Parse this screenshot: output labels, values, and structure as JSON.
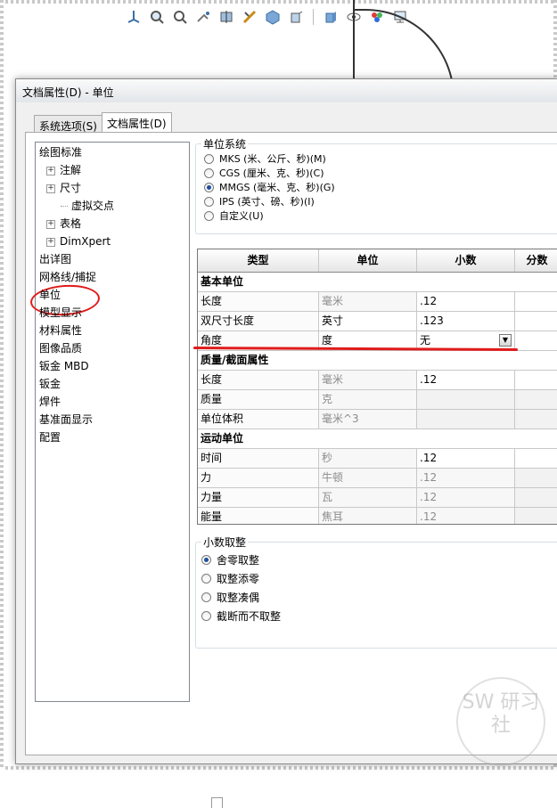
{
  "window": {
    "title": "文档属性(D) - 单位"
  },
  "tabs": [
    {
      "label": "系统选项(S)"
    },
    {
      "label": "文档属性(D)"
    }
  ],
  "tree": {
    "items": [
      {
        "label": "绘图标准",
        "indent": 0,
        "expand": false
      },
      {
        "label": "注解",
        "indent": 1,
        "expand": true
      },
      {
        "label": "尺寸",
        "indent": 1,
        "expand": true
      },
      {
        "label": "虚拟交点",
        "indent": 2,
        "expand": false
      },
      {
        "label": "表格",
        "indent": 1,
        "expand": true
      },
      {
        "label": "DimXpert",
        "indent": 1,
        "expand": true
      },
      {
        "label": "出详图",
        "indent": 0,
        "expand": false
      },
      {
        "label": "网格线/捕捉",
        "indent": 0,
        "expand": false
      },
      {
        "label": "单位",
        "indent": 0,
        "expand": false
      },
      {
        "label": "模型显示",
        "indent": 0,
        "expand": false
      },
      {
        "label": "材料属性",
        "indent": 0,
        "expand": false
      },
      {
        "label": "图像品质",
        "indent": 0,
        "expand": false
      },
      {
        "label": "钣金 MBD",
        "indent": 0,
        "expand": false
      },
      {
        "label": "钣金",
        "indent": 0,
        "expand": false
      },
      {
        "label": "焊件",
        "indent": 0,
        "expand": false
      },
      {
        "label": "基准面显示",
        "indent": 0,
        "expand": false
      },
      {
        "label": "配置",
        "indent": 0,
        "expand": false
      }
    ],
    "selected_label": "单位"
  },
  "unit_system": {
    "legend": "单位系统",
    "options": [
      {
        "label": "MKS (米、公斤、秒)(M)",
        "checked": false
      },
      {
        "label": "CGS (厘米、克、秒)(C)",
        "checked": false
      },
      {
        "label": "MMGS (毫米、克、秒)(G)",
        "checked": true
      },
      {
        "label": "IPS (英寸、磅、秒)(I)",
        "checked": false
      },
      {
        "label": "自定义(U)",
        "checked": false
      }
    ]
  },
  "grid": {
    "headers": [
      "类型",
      "单位",
      "小数",
      "分数"
    ],
    "rows": [
      {
        "kind": "section",
        "type": "基本单位"
      },
      {
        "kind": "data",
        "type": "长度",
        "unit": "毫米",
        "decimal": ".12",
        "unit_ro": true,
        "dec_ro": false
      },
      {
        "kind": "data",
        "type": "双尺寸长度",
        "unit": "英寸",
        "decimal": ".123",
        "unit_ro": false,
        "dec_ro": false
      },
      {
        "kind": "data",
        "type": "角度",
        "unit": "度",
        "decimal": "无",
        "unit_ro": false,
        "dec_ro": false,
        "dropdown": true
      },
      {
        "kind": "section",
        "type": "质量/截面属性"
      },
      {
        "kind": "data",
        "type": "长度",
        "unit": "毫米",
        "decimal": ".12",
        "unit_ro": true,
        "dec_ro": false
      },
      {
        "kind": "data",
        "type": "质量",
        "unit": "克",
        "decimal": "",
        "unit_ro": true,
        "dec_ro": true
      },
      {
        "kind": "data",
        "type": "单位体积",
        "unit": "毫米^3",
        "decimal": "",
        "unit_ro": true,
        "dec_ro": true
      },
      {
        "kind": "section",
        "type": "运动单位"
      },
      {
        "kind": "data",
        "type": "时间",
        "unit": "秒",
        "decimal": ".12",
        "unit_ro": true,
        "dec_ro": false
      },
      {
        "kind": "data",
        "type": "力",
        "unit": "牛顿",
        "decimal": ".12",
        "unit_ro": true,
        "dec_ro": true
      },
      {
        "kind": "data",
        "type": "力量",
        "unit": "瓦",
        "decimal": ".12",
        "unit_ro": true,
        "dec_ro": true
      },
      {
        "kind": "data",
        "type": "能量",
        "unit": "焦耳",
        "decimal": ".12",
        "unit_ro": true,
        "dec_ro": true
      }
    ]
  },
  "rounding": {
    "legend": "小数取整",
    "options": [
      {
        "label": "舍零取整",
        "checked": true
      },
      {
        "label": "取整添零",
        "checked": false
      },
      {
        "label": "取整凑偶",
        "checked": false
      },
      {
        "label": "截断而不取整",
        "checked": false
      }
    ]
  },
  "watermark": {
    "text": "SW 研习社"
  },
  "annotations": {
    "color": "#e01b1b"
  }
}
